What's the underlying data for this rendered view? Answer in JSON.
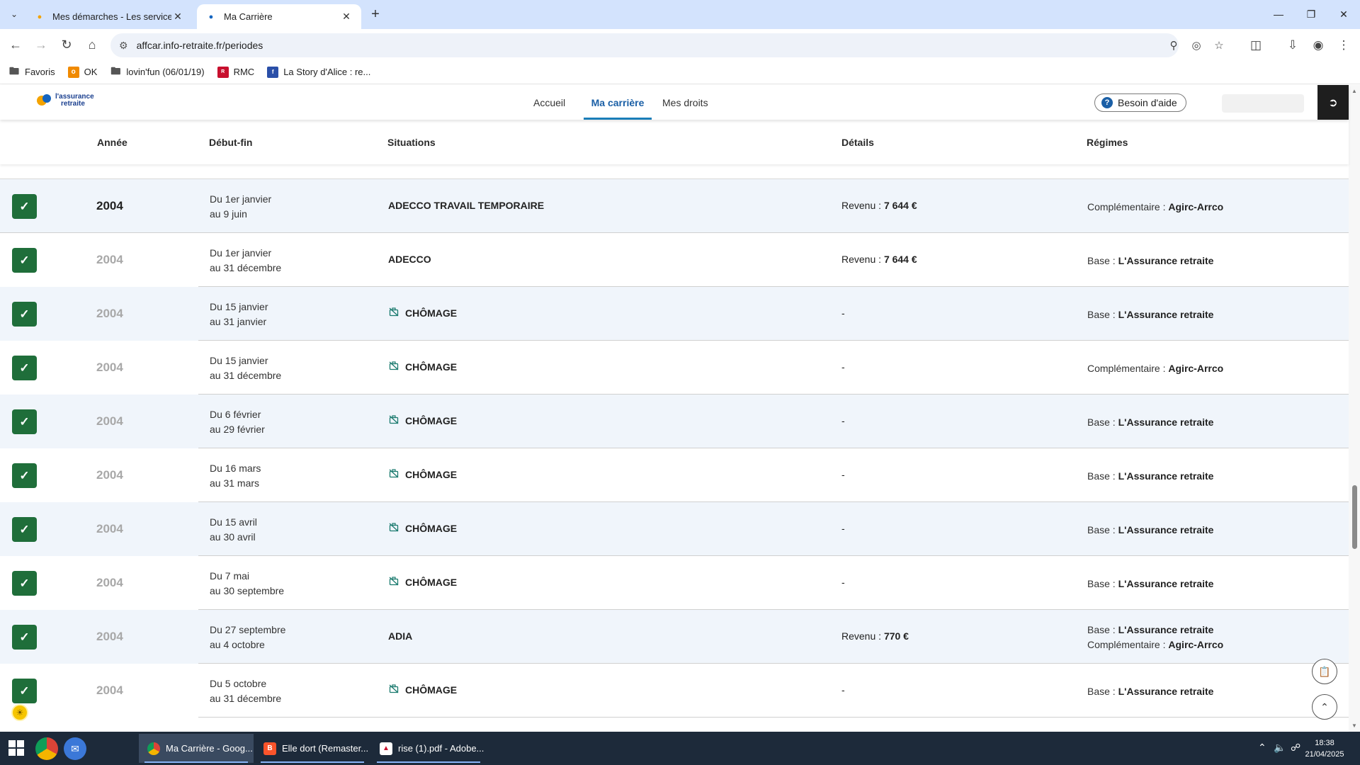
{
  "browser": {
    "tabs": [
      {
        "title": "Mes démarches - Les services o",
        "active": false
      },
      {
        "title": "Ma Carrière",
        "active": true
      }
    ],
    "url": "affcar.info-retraite.fr/periodes",
    "bookmarks": [
      {
        "label": "Favoris",
        "icon": "folder-icon"
      },
      {
        "label": "OK",
        "icon": "ok-icon"
      },
      {
        "label": "lovin'fun (06/01/19)",
        "icon": "folder-icon"
      },
      {
        "label": "RMC",
        "icon": "rmc-icon"
      },
      {
        "label": "La Story d'Alice : re...",
        "icon": "story-icon"
      }
    ]
  },
  "site": {
    "logo": {
      "line1": "l'assurance",
      "line2": "retraite"
    },
    "nav": [
      {
        "label": "Accueil",
        "active": false
      },
      {
        "label": "Ma carrière",
        "active": true
      },
      {
        "label": "Mes droits",
        "active": false
      }
    ],
    "help_label": "Besoin d'aide"
  },
  "table": {
    "headers": [
      "Année",
      "Début-fin",
      "Situations",
      "Détails",
      "Régimes"
    ],
    "rows": [
      {
        "year": "2004",
        "date_start": "Du 1er janvier",
        "date_end": "au 9 juin",
        "situation": "ADECCO TRAVAIL TEMPORAIRE",
        "chomage": false,
        "detail_label": "Revenu : ",
        "detail_value": "7 644 €",
        "regimes": [
          {
            "type": "Complémentaire : ",
            "name": "Agirc-Arrco"
          }
        ]
      },
      {
        "year": "2004",
        "date_start": "Du 1er janvier",
        "date_end": "au 31 décembre",
        "situation": "ADECCO",
        "chomage": false,
        "detail_label": "Revenu : ",
        "detail_value": "7 644 €",
        "regimes": [
          {
            "type": "Base : ",
            "name": "L'Assurance retraite"
          }
        ]
      },
      {
        "year": "2004",
        "date_start": "Du 15 janvier",
        "date_end": "au 31 janvier",
        "situation": "CHÔMAGE",
        "chomage": true,
        "detail_label": "-",
        "detail_value": "",
        "regimes": [
          {
            "type": "Base : ",
            "name": "L'Assurance retraite"
          }
        ]
      },
      {
        "year": "2004",
        "date_start": "Du 15 janvier",
        "date_end": "au 31 décembre",
        "situation": "CHÔMAGE",
        "chomage": true,
        "detail_label": "-",
        "detail_value": "",
        "regimes": [
          {
            "type": "Complémentaire : ",
            "name": "Agirc-Arrco"
          }
        ]
      },
      {
        "year": "2004",
        "date_start": "Du 6 février",
        "date_end": "au 29 février",
        "situation": "CHÔMAGE",
        "chomage": true,
        "detail_label": "-",
        "detail_value": "",
        "regimes": [
          {
            "type": "Base : ",
            "name": "L'Assurance retraite"
          }
        ]
      },
      {
        "year": "2004",
        "date_start": "Du 16 mars",
        "date_end": "au 31 mars",
        "situation": "CHÔMAGE",
        "chomage": true,
        "detail_label": "-",
        "detail_value": "",
        "regimes": [
          {
            "type": "Base : ",
            "name": "L'Assurance retraite"
          }
        ]
      },
      {
        "year": "2004",
        "date_start": "Du 15 avril",
        "date_end": "au 30 avril",
        "situation": "CHÔMAGE",
        "chomage": true,
        "detail_label": "-",
        "detail_value": "",
        "regimes": [
          {
            "type": "Base : ",
            "name": "L'Assurance retraite"
          }
        ]
      },
      {
        "year": "2004",
        "date_start": "Du 7 mai",
        "date_end": "au 30 septembre",
        "situation": "CHÔMAGE",
        "chomage": true,
        "detail_label": "-",
        "detail_value": "",
        "regimes": [
          {
            "type": "Base : ",
            "name": "L'Assurance retraite"
          }
        ]
      },
      {
        "year": "2004",
        "date_start": "Du 27 septembre",
        "date_end": "au 4 octobre",
        "situation": "ADIA",
        "chomage": false,
        "detail_label": "Revenu : ",
        "detail_value": "770 €",
        "regimes": [
          {
            "type": "Base : ",
            "name": "L'Assurance retraite"
          },
          {
            "type": "Complémentaire : ",
            "name": "Agirc-Arrco"
          }
        ]
      },
      {
        "year": "2004",
        "date_start": "Du 5 octobre",
        "date_end": "au 31 décembre",
        "situation": "CHÔMAGE",
        "chomage": true,
        "detail_label": "-",
        "detail_value": "",
        "regimes": [
          {
            "type": "Base : ",
            "name": "L'Assurance retraite"
          }
        ]
      }
    ]
  },
  "taskbar": {
    "items": [
      {
        "label": "Ma Carrière - Goog...",
        "icon": "chrome-icon",
        "active": true
      },
      {
        "label": "Elle dort (Remaster...",
        "icon": "brave-icon",
        "active": false
      },
      {
        "label": "rise (1).pdf - Adobe...",
        "icon": "pdf-icon",
        "active": false
      }
    ],
    "time": "18:38",
    "date": "21/04/2025"
  },
  "colors": {
    "accent": "#1a5fa6",
    "check_green": "#1f6e3a",
    "row_alt": "#f0f5fb",
    "tab_bar": "#d3e3fd"
  }
}
